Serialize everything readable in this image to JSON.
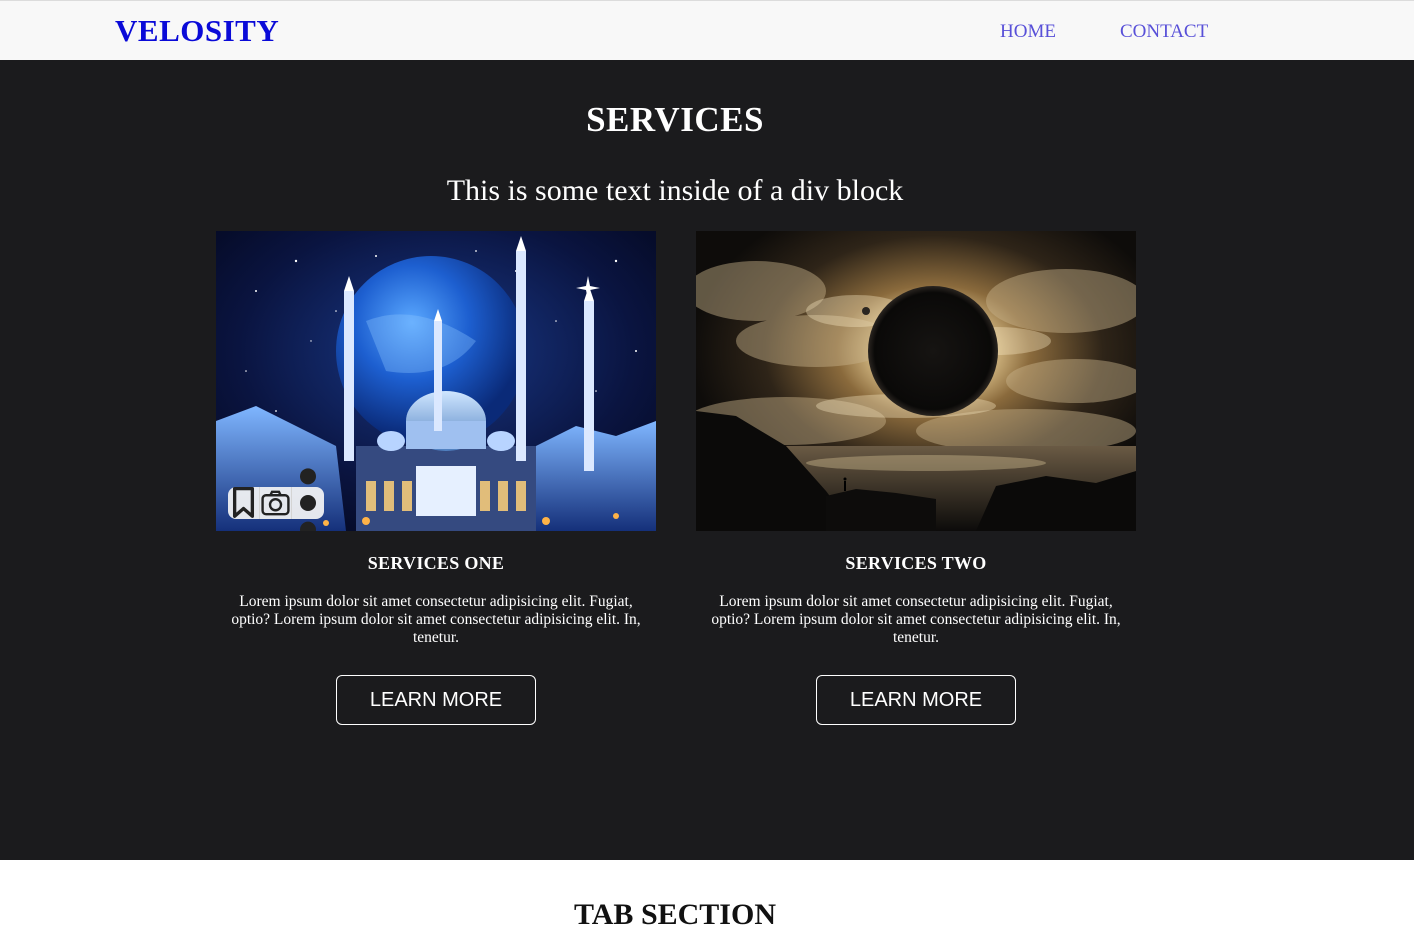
{
  "nav": {
    "brand": "VELOSITY",
    "links": [
      {
        "label": "HOME"
      },
      {
        "label": "CONTACT"
      }
    ]
  },
  "services": {
    "title": "SERVICES",
    "subtitle": "This is some text inside of a div block",
    "cards": [
      {
        "title": "SERVICES ONE",
        "text": "Lorem ipsum dolor sit amet consectetur adipisicing elit. Fugiat, optio? Lorem ipsum dolor sit amet consectetur adipisicing elit. In, tenetur.",
        "button": "LEARN MORE",
        "image": "mosque-at-night-with-planet-image"
      },
      {
        "title": "SERVICES TWO",
        "text": "Lorem ipsum dolor sit amet consectetur adipisicing elit. Fugiat, optio? Lorem ipsum dolor sit amet consectetur adipisicing elit. In, tenetur.",
        "button": "LEARN MORE",
        "image": "solar-eclipse-over-clouds-image"
      }
    ],
    "image_toolbar_icons": [
      "bookmark-icon",
      "camera-lens-icon",
      "more-vertical-icon"
    ]
  },
  "tab_section": {
    "title": "TAB SECTION"
  },
  "colors": {
    "brand": "#0a0ad8",
    "nav_link": "#5850d8",
    "services_bg": "#1b1b1d",
    "navbar_bg": "#f8f8f8"
  }
}
